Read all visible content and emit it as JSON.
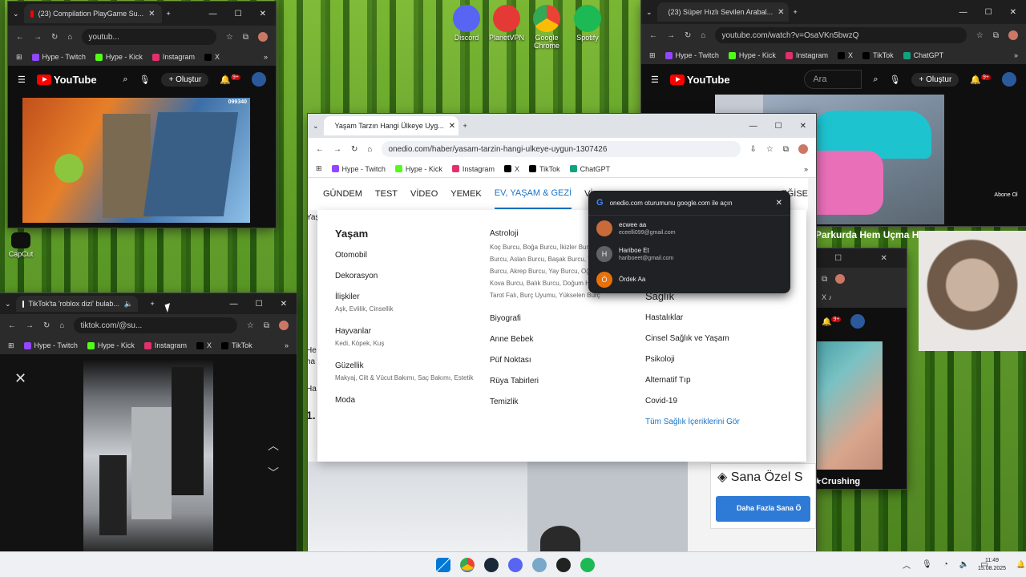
{
  "desktop": {
    "icons": [
      {
        "label": "Discord",
        "color": "#5865f2"
      },
      {
        "label": "PlanetVPN",
        "color": "#e53935"
      },
      {
        "label": "Google Chrome",
        "color": "#4285f4"
      },
      {
        "label": "Spotify",
        "color": "#1db954"
      }
    ],
    "capcut_label": "CapCut"
  },
  "win_yt_left": {
    "tab_title": "(23) Compilation PlayGame Su...",
    "url": "youtub...",
    "bookmarks": [
      "Hype - Twitch",
      "Hype - Kick",
      "Instagram",
      "X"
    ],
    "create_label": "Oluştur",
    "notif_count": "9+",
    "score": "099340"
  },
  "win_yt_right": {
    "tab_title": "(23) Süper Hızlı Sevilen Arabal...",
    "url": "youtube.com/watch?v=OsaVKn5bwzQ",
    "bookmarks": [
      "Hype - Twitch",
      "Hype - Kick",
      "Instagram",
      "X",
      "TikTok",
      "ChatGPT"
    ],
    "search_placeholder": "Ara",
    "create_label": "Oluştur",
    "notif_count": "9+",
    "overlay_text": "Parkurda Hem Uçma H",
    "channel_badge": "Abone Ol"
  },
  "win_tiktok": {
    "tab_title": "TikTok'ta 'roblox dizi' bulab...",
    "url": "tiktok.com/@su...",
    "bookmarks": [
      "Hype - Twitch",
      "Hype - Kick",
      "Instagram",
      "X",
      "TikTok"
    ]
  },
  "win_mid": {
    "notif_count": "9+",
    "overlay_title": "Crushing"
  },
  "win_onedio": {
    "tab_title": "Yaşam Tarzın Hangi Ülkeye Uyg...",
    "url": "onedio.com/haber/yasam-tarzin-hangi-ulkeye-uygun-1307426",
    "bookmarks": [
      "Hype - Twitch",
      "Hype - Kick",
      "Instagram",
      "X",
      "TikTok",
      "ChatGPT"
    ],
    "nav": [
      "GÜNDEM",
      "TEST",
      "VİDEO",
      "YEMEK",
      "EV, YAŞAM & GEZİ",
      "Vİ",
      "EĞİSE"
    ],
    "mega": {
      "yasam_title": "Yaşam",
      "yasam_items": [
        {
          "label": "Otomobil",
          "sub": ""
        },
        {
          "label": "Dekorasyon",
          "sub": ""
        },
        {
          "label": "İlişkiler",
          "sub": "Aşk, Evlilik, Cinsellik"
        },
        {
          "label": "Hayvanlar",
          "sub": "Kedi, Köpek, Kuş"
        },
        {
          "label": "Güzellik",
          "sub": "Makyaj, Cilt & Vücut Bakımı, Saç Bakımı, Estetik"
        },
        {
          "label": "Moda",
          "sub": ""
        }
      ],
      "astro_title": "Astroloji",
      "astro_sub": "Koç Burcu, Boğa Burcu, İkizler Burcu, Yengeç Burcu, Aslan Burcu, Başak Burcu, Terazi Burcu, Akrep Burcu, Yay Burcu, Oğlak Burcu, Kova Burcu, Balık Burcu, Doğum Haritası, Tarot Falı, Burç Uyumu, Yükselen Burç",
      "mid_items": [
        "Biyografi",
        "Anne Bebek",
        "Püf Noktası",
        "Rüya Tabirleri",
        "Temizlik"
      ],
      "saglik_title": "Sağlık",
      "saglik_items": [
        "Hastalıklar",
        "Cinsel Sağlık ve Yaşam",
        "Psikoloji",
        "Alternatif Tıp",
        "Covid-19"
      ],
      "saglik_link": "Tüm Sağlık İçeriklerini Gör"
    },
    "left_fragments": [
      "Yaş",
      "He",
      "ha",
      "Ha",
      "1."
    ],
    "side_card_title": "Sana Özel S",
    "side_card_button": "Daha Fazla Sana Ö",
    "google_popup": {
      "title": "onedio.com oturumunu google.com ile açın",
      "accounts": [
        {
          "name": "ecwee aa",
          "email": "eceelli099@gmail.com",
          "initial": ""
        },
        {
          "name": "Hariboe Et",
          "email": "hariboeet@gmail.com",
          "initial": "H"
        },
        {
          "name": "Ördek Aa",
          "email": "",
          "initial": "Ö"
        }
      ]
    }
  },
  "taskbar": {
    "time": "11:49",
    "date": "15.08.2025"
  }
}
